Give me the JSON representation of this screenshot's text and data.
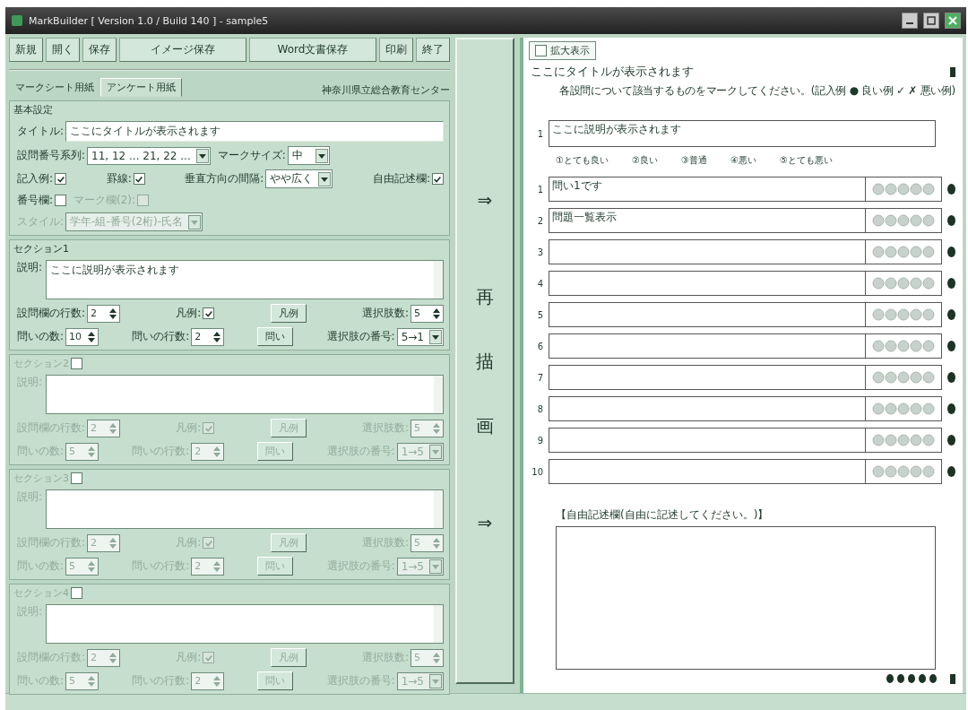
{
  "window": {
    "title": "MarkBuilder [ Version 1.0 / Build 140 ] - sample5"
  },
  "toolbar": [
    "新規",
    "開く",
    "保存",
    "イメージ保存",
    "Word文書保存",
    "印刷",
    "終了"
  ],
  "tabs": [
    {
      "label": "マークシート用紙",
      "selected": false
    },
    {
      "label": "アンケート用紙",
      "selected": true
    }
  ],
  "organization": "神奈川県立総合教育センター",
  "basic_settings": {
    "legend": "基本設定",
    "lines": [
      [
        {
          "kind": "text",
          "label": "タイトル:",
          "value": "ここにタイトルが表示されます",
          "disabled": false
        }
      ],
      [
        {
          "kind": "select",
          "label": "設問番号系列:",
          "value": "11, 12 ... 21, 22 ...",
          "disabled": false
        },
        {
          "kind": "select",
          "label": "マークサイズ:",
          "value": "中",
          "disabled": false
        }
      ],
      [
        {
          "kind": "check",
          "label": "記入例:",
          "checked": true,
          "disabled": false
        },
        {
          "kind": "check",
          "label": "罫線:",
          "checked": true,
          "disabled": false
        },
        {
          "kind": "select",
          "label": "垂直方向の間隔:",
          "value": "やや広く",
          "disabled": false
        },
        {
          "kind": "check",
          "label": "自由記述欄:",
          "checked": true,
          "disabled": false
        }
      ],
      [
        {
          "kind": "check",
          "label": "番号欄:",
          "checked": false,
          "disabled": false
        },
        {
          "kind": "check",
          "label": "マーク欄(2):",
          "checked": false,
          "disabled": true
        }
      ],
      [
        {
          "kind": "select",
          "label": "スタイル:",
          "value": "学年-組-番号(2桁)-氏名",
          "disabled": true
        }
      ]
    ]
  },
  "sections": [
    {
      "kind": "fixed",
      "title": "セクション1",
      "disabled": false,
      "description_label": "説明:",
      "description": "ここに説明が表示されます",
      "rows": [
        [
          {
            "kind": "spin",
            "label": "設問欄の行数:",
            "value": "2"
          },
          {
            "kind": "check",
            "label": "凡例:",
            "checked": true
          },
          {
            "kind": "button",
            "label": "凡例"
          },
          {
            "kind": "spin",
            "label": "選択肢数:",
            "value": "5"
          }
        ],
        [
          {
            "kind": "spin",
            "label": "問いの数:",
            "value": "10"
          },
          {
            "kind": "spin",
            "label": "問いの行数:",
            "value": "2"
          },
          {
            "kind": "button",
            "label": "問い"
          },
          {
            "kind": "select",
            "label": "選択肢の番号:",
            "value": "5→1"
          }
        ]
      ]
    },
    {
      "kind": "optional",
      "title": "セクション2",
      "checked": false,
      "disabled": true,
      "description_label": "説明:",
      "rows": [
        [
          {
            "kind": "spin",
            "label": "設問欄の行数:",
            "value": "2"
          },
          {
            "kind": "check",
            "label": "凡例:",
            "checked": true
          },
          {
            "kind": "button",
            "label": "凡例"
          },
          {
            "kind": "spin",
            "label": "選択肢数:",
            "value": "5"
          }
        ],
        [
          {
            "kind": "spin",
            "label": "問いの数:",
            "value": "5"
          },
          {
            "kind": "spin",
            "label": "問いの行数:",
            "value": "2"
          },
          {
            "kind": "button",
            "label": "問い"
          },
          {
            "kind": "select",
            "label": "選択肢の番号:",
            "value": "1→5"
          }
        ]
      ]
    },
    {
      "kind": "optional",
      "title": "セクション3",
      "checked": false,
      "disabled": true,
      "description_label": "説明:",
      "rows": [
        [
          {
            "kind": "spin",
            "label": "設問欄の行数:",
            "value": "2"
          },
          {
            "kind": "check",
            "label": "凡例:",
            "checked": true
          },
          {
            "kind": "button",
            "label": "凡例"
          },
          {
            "kind": "spin",
            "label": "選択肢数:",
            "value": "5"
          }
        ],
        [
          {
            "kind": "spin",
            "label": "問いの数:",
            "value": "5"
          },
          {
            "kind": "spin",
            "label": "問いの行数:",
            "value": "2"
          },
          {
            "kind": "button",
            "label": "問い"
          },
          {
            "kind": "select",
            "label": "選択肢の番号:",
            "value": "1→5"
          }
        ]
      ]
    },
    {
      "kind": "optional",
      "title": "セクション4",
      "checked": false,
      "disabled": true,
      "description_label": "説明:",
      "rows": [
        [
          {
            "kind": "spin",
            "label": "設問欄の行数:",
            "value": "2"
          },
          {
            "kind": "check",
            "label": "凡例:",
            "checked": true
          },
          {
            "kind": "button",
            "label": "凡例"
          },
          {
            "kind": "spin",
            "label": "選択肢数:",
            "value": "5"
          }
        ],
        [
          {
            "kind": "spin",
            "label": "問いの数:",
            "value": "5"
          },
          {
            "kind": "spin",
            "label": "問いの行数:",
            "value": "2"
          },
          {
            "kind": "button",
            "label": "問い"
          },
          {
            "kind": "select",
            "label": "選択肢の番号:",
            "value": "1→5"
          }
        ]
      ]
    }
  ],
  "redraw_button": {
    "arrow_top": "⇒",
    "label": "再描画",
    "arrow_bottom": "⇒"
  },
  "preview": {
    "zoom": {
      "label": "拡大表示",
      "checked": false
    },
    "title": "ここにタイトルが表示されます",
    "instructions": "各設問について該当するものをマークしてください。(記入例 ● 良い例 ✓ ✗ 悪い例)",
    "question": {
      "number": "1",
      "text": "ここに説明が表示されます"
    },
    "legend": [
      "①とても良い",
      "②良い",
      "③普通",
      "④悪い",
      "⑤とても悪い"
    ],
    "items": [
      {
        "number": "1",
        "text": "問い1です"
      },
      {
        "number": "2",
        "text": "問題一覧表示"
      },
      {
        "number": "3"
      },
      {
        "number": "4"
      },
      {
        "number": "5"
      },
      {
        "number": "6"
      },
      {
        "number": "7"
      },
      {
        "number": "8"
      },
      {
        "number": "9"
      },
      {
        "number": "10"
      }
    ],
    "free_label": "【自由記述欄(自由に記述してください。)】"
  }
}
